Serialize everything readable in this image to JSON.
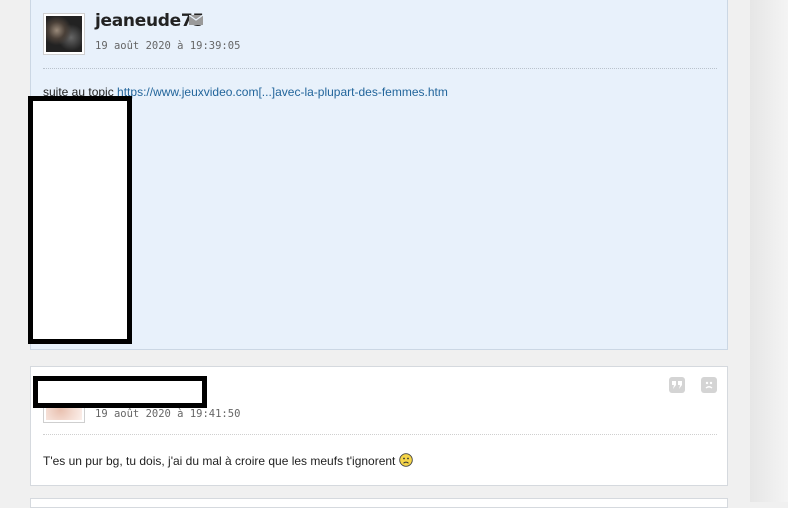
{
  "posts": [
    {
      "author": "jeaneude75",
      "timestamp": "19 août 2020 à 19:39:05",
      "text_prefix": "suite au topic ",
      "link_text": "https://www.jeuxvideo.com[...]avec-la-plupart-des-femmes.htm",
      "icons": [
        "mail-icon"
      ]
    },
    {
      "author": "",
      "timestamp": "19 août 2020 à 19:41:50",
      "text": "T'es un pur bg, tu dois, j'ai du mal à croire que les meufs t'ignorent",
      "icons": [
        "quote-icon",
        "report-icon",
        "sad-smiley-icon"
      ]
    }
  ],
  "colors": {
    "first_post_bg": "#e8f1fb",
    "link": "#22659b",
    "page_bg": "#f0f0f0"
  }
}
